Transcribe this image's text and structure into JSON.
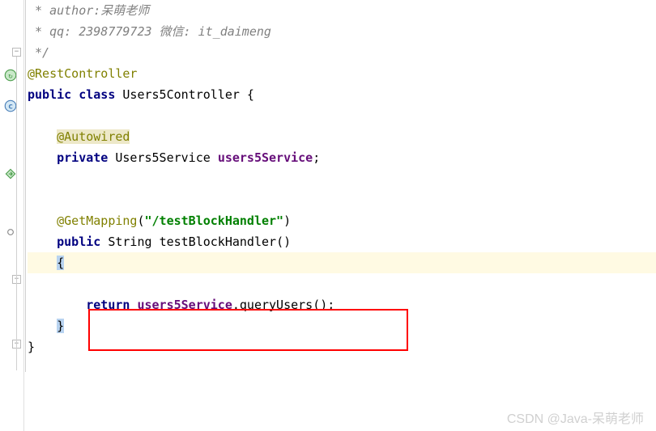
{
  "code": {
    "comment1": " * author:呆萌老师",
    "comment2": " * qq: 2398779723 微信: it_daimeng",
    "comment3": " */",
    "anno1": "@RestController",
    "kw_public": "public",
    "kw_class": "class",
    "classname": "Users5Controller",
    "brace_open": " {",
    "anno2": "@Autowired",
    "kw_private": "private",
    "type1": "Users5Service",
    "field1": "users5Service",
    "semi": ";",
    "anno3": "@GetMapping",
    "paren_open": "(",
    "string1": "\"/testBlockHandler\"",
    "paren_close": ")",
    "type2": "String",
    "method1": "testBlockHandler",
    "parens": "()",
    "brace_open2": "{",
    "kw_return": "return",
    "field2": "users5Service",
    "dot": ".",
    "method2": "queryUsers",
    "call": "();",
    "brace_close2": "}",
    "brace_close": "}"
  },
  "watermark": "CSDN @Java-呆萌老师"
}
